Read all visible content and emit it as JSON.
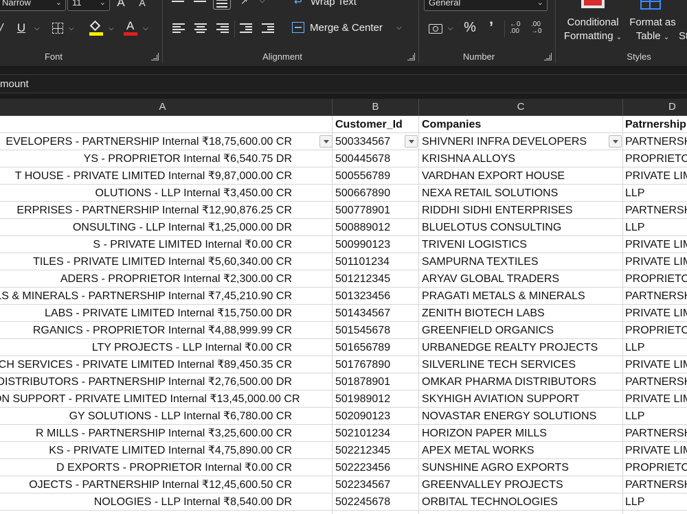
{
  "ribbon": {
    "font_group": {
      "label": "Font",
      "font_name": "Narrow",
      "font_size": "11",
      "bold_italic_hint": "A",
      "underline": "U",
      "font_color_glyph": "A",
      "fill_color": "#ffee00",
      "font_color": "#e02020"
    },
    "alignment_group": {
      "label": "Alignment",
      "wrap_text": "Wrap Text",
      "merge_center": "Merge & Center"
    },
    "number_group": {
      "label": "Number",
      "format": "General",
      "percent": "%",
      "comma": "’"
    },
    "styles_group": {
      "label": "Styles",
      "conditional_formatting_line1": "Conditional",
      "conditional_formatting_line2": "Formatting",
      "format_as_table_line1": "Format as",
      "format_as_table_line2": "Table",
      "cell_styles_partial": "St"
    }
  },
  "formula_bar": {
    "text": "mount"
  },
  "columns": [
    "A",
    "B",
    "C",
    "D"
  ],
  "table": {
    "header": {
      "b": "Customer_Id",
      "c": "Companies",
      "d": "Patrnership"
    },
    "rows": [
      {
        "a": "EVELOPERS - PARTNERSHIP  Internal ₹18,75,600.00 CR",
        "b": "500334567",
        "c": "SHIVNERI INFRA DEVELOPERS",
        "d": "PARTNERSHIP"
      },
      {
        "a": "YS - PROPRIETOR  Internal ₹6,540.75 DR",
        "b": "500445678",
        "c": "KRISHNA ALLOYS",
        "d": "PROPRIETOR"
      },
      {
        "a": "T HOUSE - PRIVATE LIMITED  Internal ₹9,87,000.00 CR",
        "b": "500556789",
        "c": "VARDHAN EXPORT HOUSE",
        "d": "PRIVATE LIMITED"
      },
      {
        "a": "OLUTIONS - LLP  Internal ₹3,450.00 CR",
        "b": "500667890",
        "c": "NEXA RETAIL SOLUTIONS",
        "d": "LLP"
      },
      {
        "a": "ERPRISES - PARTNERSHIP  Internal ₹12,90,876.25 CR",
        "b": "500778901",
        "c": "RIDDHI SIDHI ENTERPRISES",
        "d": "PARTNERSHIP"
      },
      {
        "a": "ONSULTING - LLP  Internal ₹1,25,000.00 DR",
        "b": "500889012",
        "c": "BLUELOTUS CONSULTING",
        "d": "LLP"
      },
      {
        "a": "S - PRIVATE LIMITED  Internal ₹0.00 CR",
        "b": "500990123",
        "c": "TRIVENI LOGISTICS",
        "d": "PRIVATE LIMITED"
      },
      {
        "a": "TILES - PRIVATE LIMITED  Internal ₹5,60,340.00 CR",
        "b": "501101234",
        "c": "SAMPURNA TEXTILES",
        "d": "PRIVATE LIMITED"
      },
      {
        "a": "ADERS - PROPRIETOR  Internal ₹2,300.00 CR",
        "b": "501212345",
        "c": "ARYAV GLOBAL TRADERS",
        "d": "PROPRIETOR"
      },
      {
        "a": "LS & MINERALS - PARTNERSHIP  Internal ₹7,45,210.90 CR",
        "b": "501323456",
        "c": "PRAGATI METALS & MINERALS",
        "d": "PARTNERSHIP"
      },
      {
        "a": "LABS - PRIVATE LIMITED  Internal ₹15,750.00 DR",
        "b": "501434567",
        "c": "ZENITH BIOTECH LABS",
        "d": "PRIVATE LIMITED"
      },
      {
        "a": "RGANICS - PROPRIETOR  Internal ₹4,88,999.99 CR",
        "b": "501545678",
        "c": "GREENFIELD ORGANICS",
        "d": "PROPRIETOR"
      },
      {
        "a": "LTY PROJECTS - LLP  Internal ₹0.00 CR",
        "b": "501656789",
        "c": "URBANEDGE REALTY PROJECTS",
        "d": "LLP"
      },
      {
        "a": "CH SERVICES - PRIVATE LIMITED  Internal ₹89,450.35 CR",
        "b": "501767890",
        "c": "SILVERLINE TECH SERVICES",
        "d": "PRIVATE LIMITED"
      },
      {
        "a": "DISTRIBUTORS - PARTNERSHIP  Internal ₹2,76,500.00 DR",
        "b": "501878901",
        "c": "OMKAR PHARMA DISTRIBUTORS",
        "d": "PARTNERSHIP"
      },
      {
        "a": "ON SUPPORT - PRIVATE LIMITED  Internal ₹13,45,000.00 CR",
        "b": "501989012",
        "c": "SKYHIGH AVIATION SUPPORT",
        "d": "PRIVATE LIMITED"
      },
      {
        "a": "GY SOLUTIONS - LLP  Internal ₹6,780.00 CR",
        "b": "502090123",
        "c": "NOVASTAR ENERGY SOLUTIONS",
        "d": "LLP"
      },
      {
        "a": "R MILLS - PARTNERSHIP  Internal ₹3,25,600.00 CR",
        "b": "502101234",
        "c": "HORIZON PAPER MILLS",
        "d": "PARTNERSHIP"
      },
      {
        "a": "KS - PRIVATE LIMITED  Internal ₹4,75,890.00 CR",
        "b": "502212345",
        "c": "APEX METAL WORKS",
        "d": "PRIVATE LIMITED"
      },
      {
        "a": "D EXPORTS - PROPRIETOR  Internal ₹0.00 CR",
        "b": "502223456",
        "c": "SUNSHINE AGRO EXPORTS",
        "d": "PROPRIETOR"
      },
      {
        "a": "OJECTS - PARTNERSHIP  Internal ₹12,45,600.50 CR",
        "b": "502234567",
        "c": "GREENVALLEY PROJECTS",
        "d": "PARTNERSHIP"
      },
      {
        "a": "NOLOGIES - LLP  Internal ₹8,540.00 DR",
        "b": "502245678",
        "c": "ORBITAL TECHNOLOGIES",
        "d": "LLP"
      }
    ]
  }
}
